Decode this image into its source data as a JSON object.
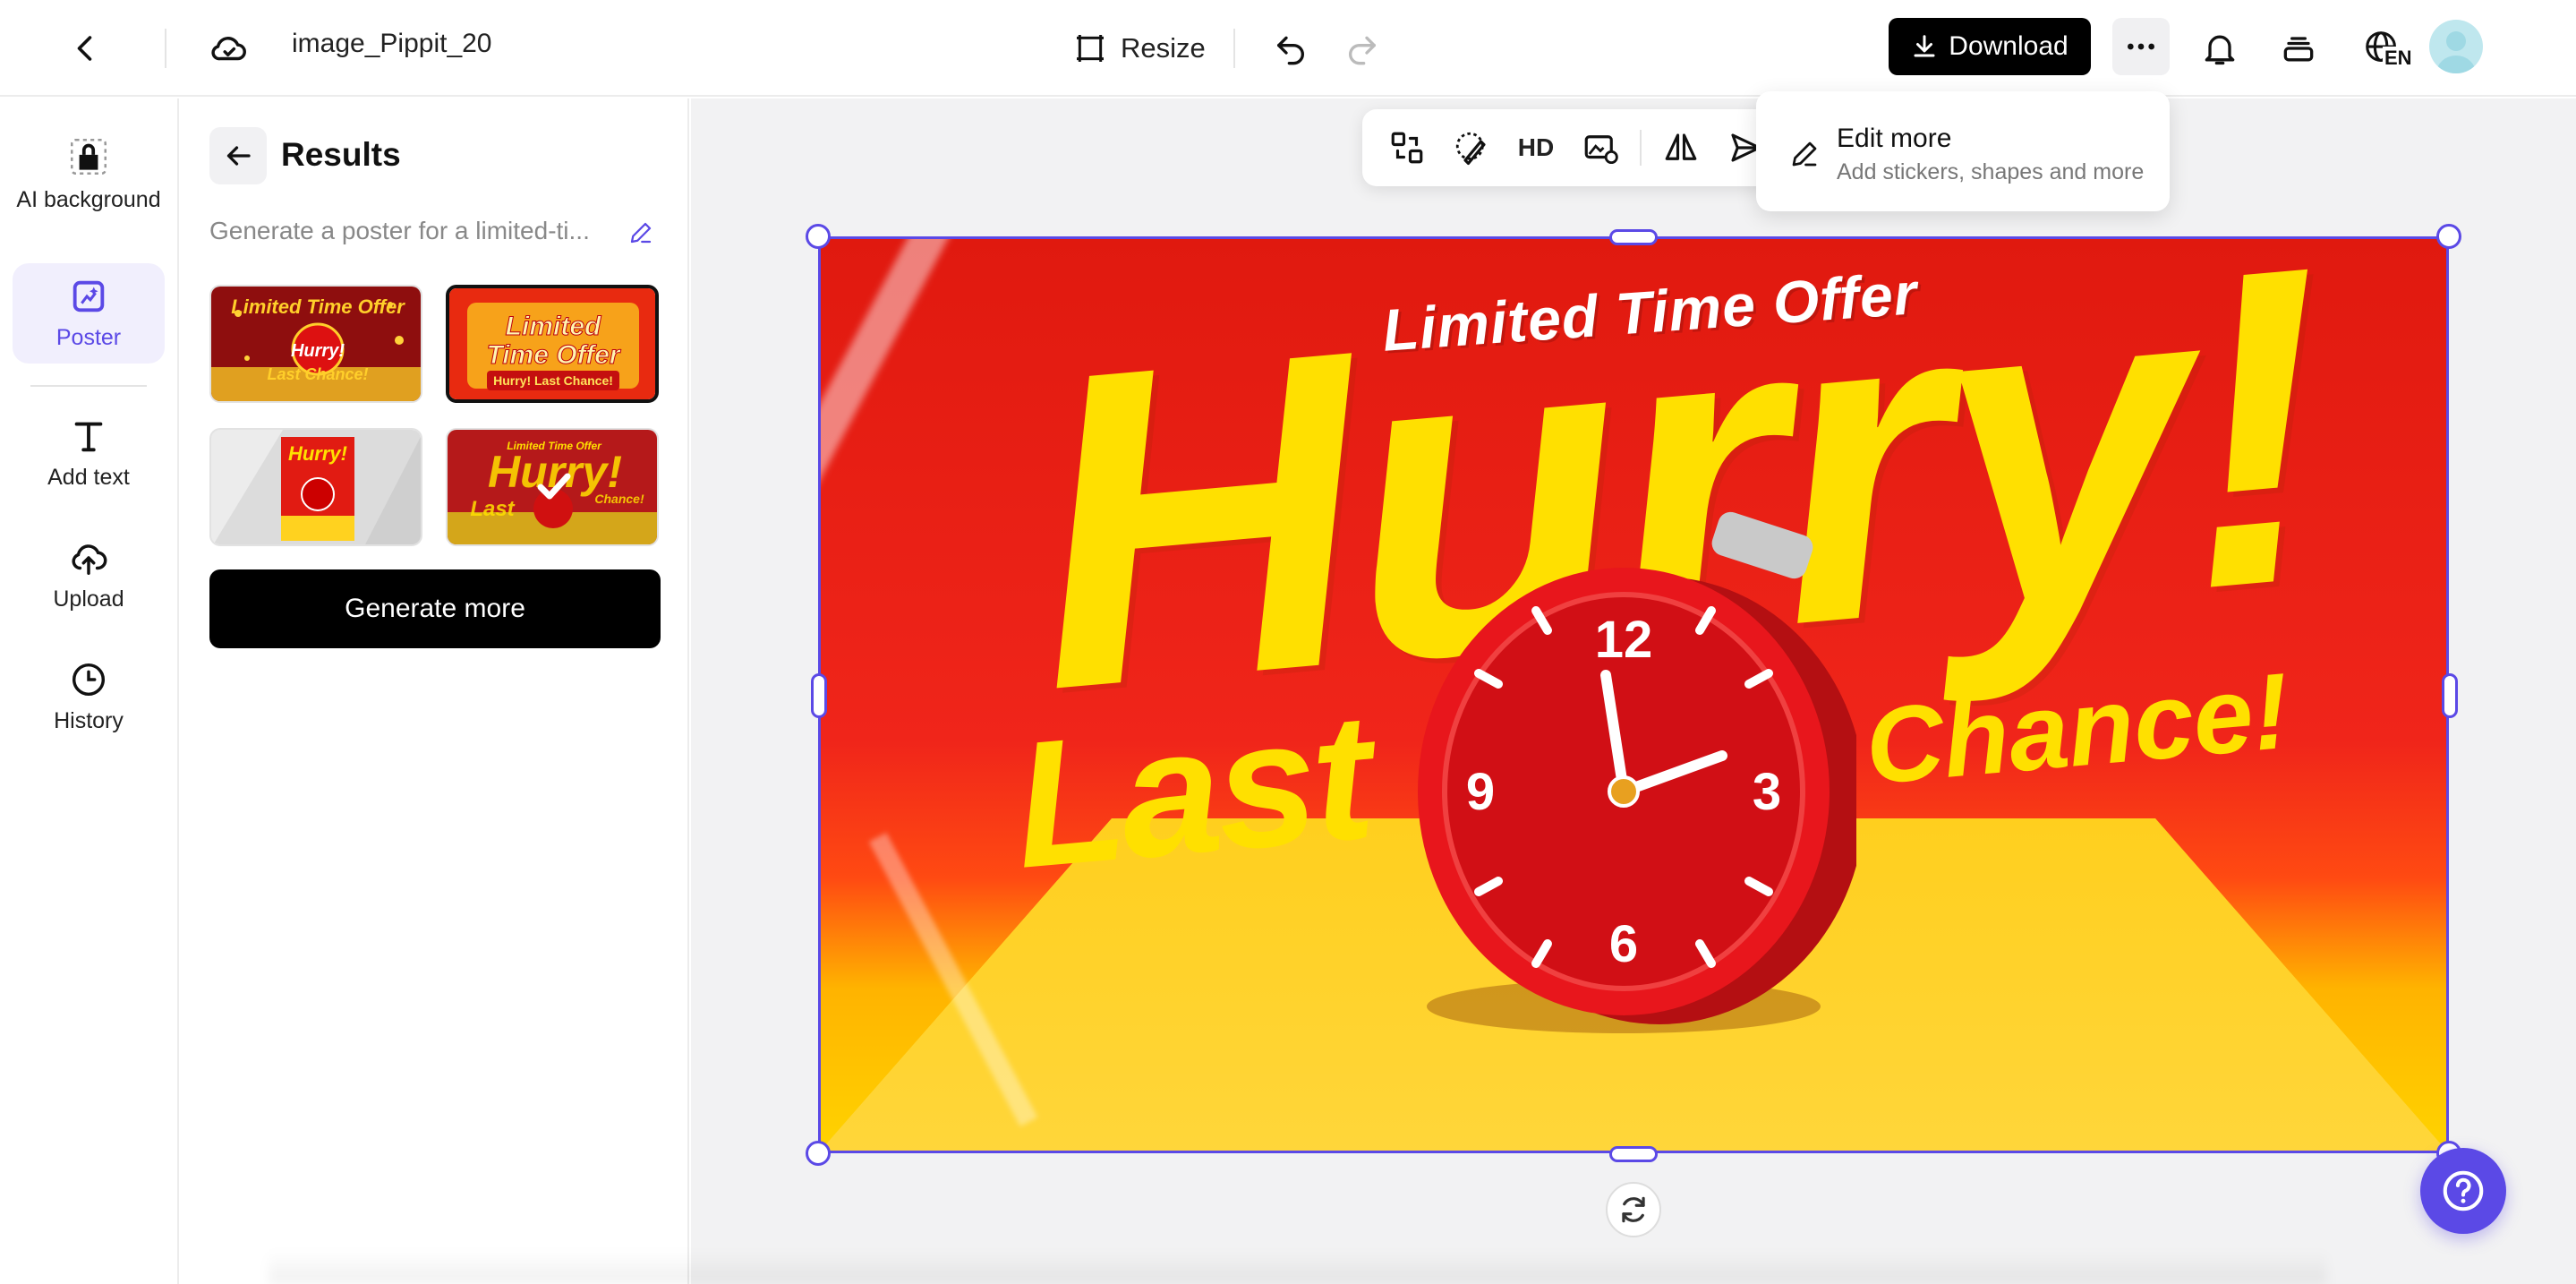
{
  "header": {
    "filename": "image_Pippit_20",
    "resize_label": "Resize",
    "download_label": "Download",
    "lang_code": "EN"
  },
  "rail": {
    "items": [
      {
        "label": "AI background",
        "icon": "bag-icon"
      },
      {
        "label": "Poster",
        "icon": "poster-icon",
        "active": true
      },
      {
        "label": "Add text",
        "icon": "text-icon"
      },
      {
        "label": "Upload",
        "icon": "upload-cloud-icon"
      },
      {
        "label": "History",
        "icon": "clock-icon"
      }
    ]
  },
  "panel": {
    "title": "Results",
    "prompt": "Generate a poster for a limited-ti...",
    "generate_more": "Generate more",
    "thumbnails": [
      {
        "caption": "Limited Time Offer Hurry! Last Chance!"
      },
      {
        "caption": "Limited Time Offer Hurry! Last Chance!"
      },
      {
        "caption": "Hurry!"
      },
      {
        "caption": "Limited Time Offer Hurry! Last Chance!",
        "selected": true
      }
    ]
  },
  "toolbar": {
    "hd_label": "HD"
  },
  "dropdown": {
    "title": "Edit more",
    "subtitle": "Add stickers, shapes and more"
  },
  "poster": {
    "line1": "Limited Time Offer",
    "line2": "Hurry!",
    "line3": "Last",
    "line4": "Chance!"
  },
  "colors": {
    "accent": "#5b49e6",
    "poster_red": "#e0190f",
    "poster_yellow": "#ffe000"
  }
}
